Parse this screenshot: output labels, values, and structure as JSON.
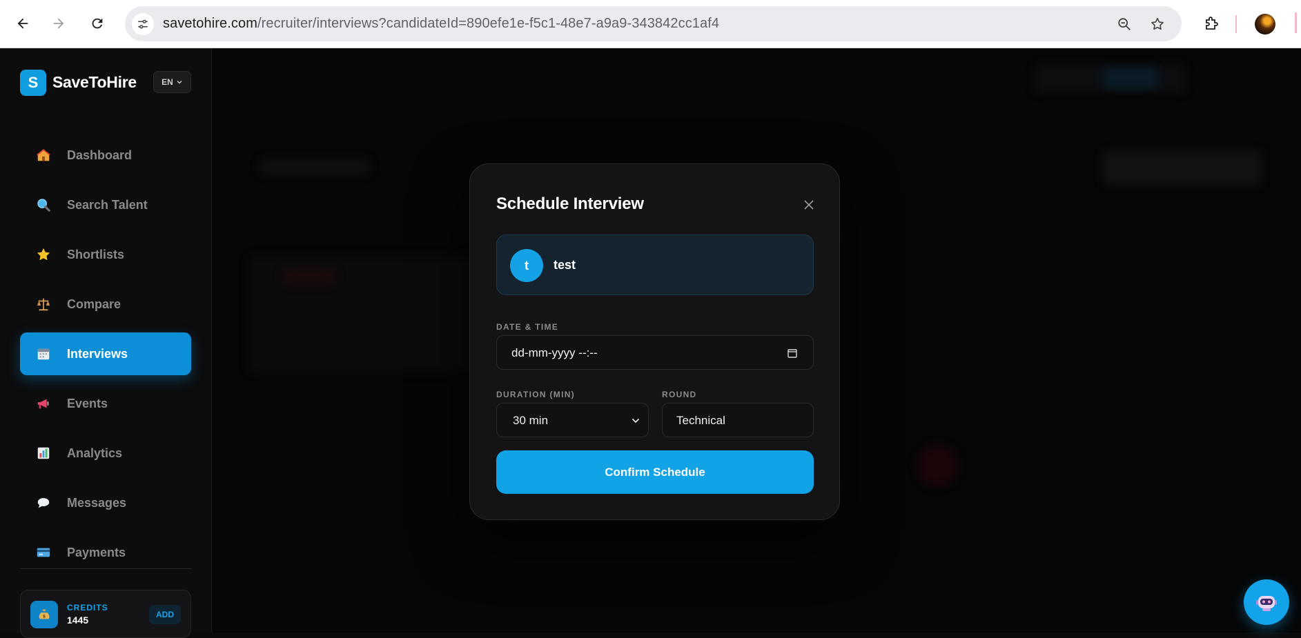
{
  "browser": {
    "url_host": "savetohire.com",
    "url_path": "/recruiter/interviews?candidateId=890efe1e-f5c1-48e7-a9a9-343842cc1af4"
  },
  "sidebar": {
    "brand_letter": "S",
    "brand_name": "SaveToHire",
    "language": "EN",
    "items": [
      {
        "label": "Dashboard",
        "icon": "house-icon"
      },
      {
        "label": "Search Talent",
        "icon": "magnifier-icon"
      },
      {
        "label": "Shortlists",
        "icon": "star-icon"
      },
      {
        "label": "Compare",
        "icon": "balance-scale-icon"
      },
      {
        "label": "Interviews",
        "icon": "calendar-icon",
        "active": true
      },
      {
        "label": "Events",
        "icon": "megaphone-icon"
      },
      {
        "label": "Analytics",
        "icon": "bar-chart-icon"
      },
      {
        "label": "Messages",
        "icon": "speech-bubble-icon"
      },
      {
        "label": "Payments",
        "icon": "credit-card-icon"
      }
    ],
    "credits": {
      "label": "CREDITS",
      "value": "1445",
      "add_label": "ADD"
    }
  },
  "modal": {
    "title": "Schedule Interview",
    "candidate": {
      "initial": "t",
      "name": "test"
    },
    "date_time": {
      "label": "DATE & TIME",
      "placeholder": "dd-mm-yyyy --:--"
    },
    "duration": {
      "label": "DURATION (MIN)",
      "selected": "30 min"
    },
    "round": {
      "label": "ROUND",
      "value": "Technical"
    },
    "confirm_label": "Confirm Schedule"
  },
  "colors": {
    "accent": "#12a2e6",
    "active_nav": "#0c8fd6",
    "background": "#0b0b0c",
    "modal_bg": "#141415"
  }
}
